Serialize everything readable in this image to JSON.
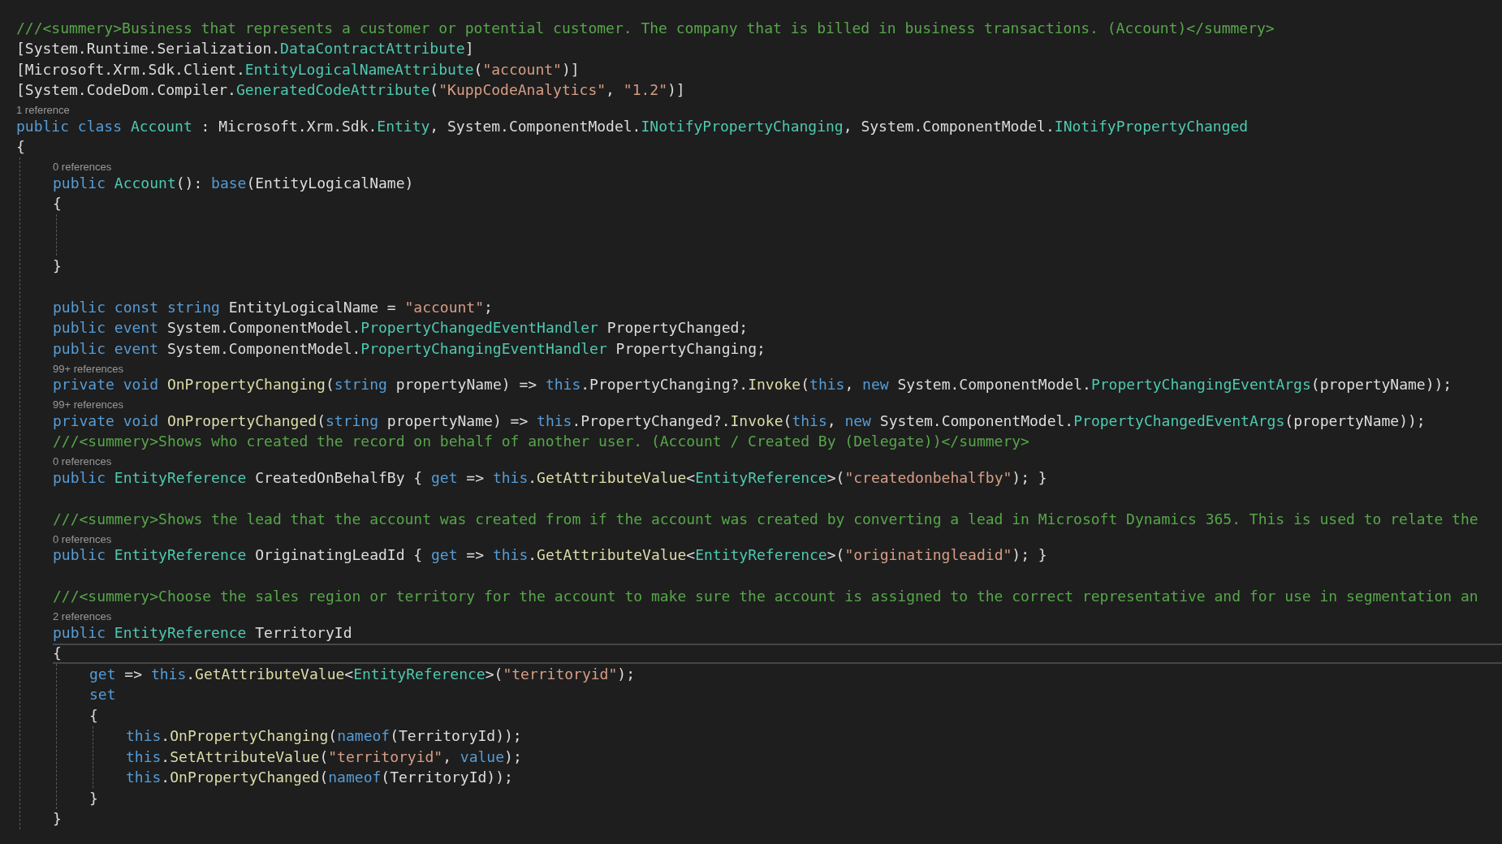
{
  "editor": {
    "lines": [
      {
        "kind": "code",
        "current": false,
        "tokens": [
          {
            "kind": "comment",
            "text": "///<summery>Business that represents a customer or potential customer. The company that is billed in business transactions. (Account)</summery>"
          }
        ]
      },
      {
        "kind": "code",
        "current": false,
        "tokens": [
          {
            "kind": "plain",
            "text": "[System.Runtime.Serialization."
          },
          {
            "kind": "type",
            "text": "DataContractAttribute"
          },
          {
            "kind": "plain",
            "text": "]"
          }
        ]
      },
      {
        "kind": "code",
        "current": false,
        "tokens": [
          {
            "kind": "plain",
            "text": "[Microsoft.Xrm.Sdk.Client."
          },
          {
            "kind": "type",
            "text": "EntityLogicalNameAttribute"
          },
          {
            "kind": "plain",
            "text": "("
          },
          {
            "kind": "string",
            "text": "\"account\""
          },
          {
            "kind": "plain",
            "text": ")]"
          }
        ]
      },
      {
        "kind": "code",
        "current": false,
        "tokens": [
          {
            "kind": "plain",
            "text": "[System.CodeDom.Compiler."
          },
          {
            "kind": "type",
            "text": "GeneratedCodeAttribute"
          },
          {
            "kind": "plain",
            "text": "("
          },
          {
            "kind": "string",
            "text": "\"KuppCodeAnalytics\""
          },
          {
            "kind": "plain",
            "text": ", "
          },
          {
            "kind": "string",
            "text": "\"1.2\""
          },
          {
            "kind": "plain",
            "text": ")]"
          }
        ]
      },
      {
        "kind": "lens",
        "text": "1 reference"
      },
      {
        "kind": "code",
        "current": false,
        "tokens": [
          {
            "kind": "keyword",
            "text": "public class "
          },
          {
            "kind": "type",
            "text": "Account"
          },
          {
            "kind": "plain",
            "text": " : Microsoft.Xrm.Sdk."
          },
          {
            "kind": "type",
            "text": "Entity"
          },
          {
            "kind": "plain",
            "text": ", System.ComponentModel."
          },
          {
            "kind": "type",
            "text": "INotifyPropertyChanging"
          },
          {
            "kind": "plain",
            "text": ", System.ComponentModel."
          },
          {
            "kind": "type",
            "text": "INotifyPropertyChanged"
          }
        ]
      },
      {
        "kind": "code",
        "current": false,
        "tokens": [
          {
            "kind": "plain",
            "text": "{"
          }
        ],
        "children": [
          {
            "kind": "lens",
            "text": "0 references"
          },
          {
            "kind": "code",
            "current": false,
            "tokens": [
              {
                "kind": "keyword",
                "text": "public "
              },
              {
                "kind": "type",
                "text": "Account"
              },
              {
                "kind": "plain",
                "text": "(): "
              },
              {
                "kind": "keyword",
                "text": "base"
              },
              {
                "kind": "plain",
                "text": "(EntityLogicalName)"
              }
            ]
          },
          {
            "kind": "code",
            "current": false,
            "tokens": [
              {
                "kind": "plain",
                "text": "{"
              }
            ],
            "children": [
              {
                "kind": "blank"
              },
              {
                "kind": "blank"
              }
            ]
          },
          {
            "kind": "code",
            "current": false,
            "tokens": [
              {
                "kind": "plain",
                "text": "}"
              }
            ]
          },
          {
            "kind": "blank"
          },
          {
            "kind": "code",
            "current": false,
            "tokens": [
              {
                "kind": "keyword",
                "text": "public const string "
              },
              {
                "kind": "plain",
                "text": "EntityLogicalName = "
              },
              {
                "kind": "string",
                "text": "\"account\""
              },
              {
                "kind": "plain",
                "text": ";"
              }
            ]
          },
          {
            "kind": "code",
            "current": false,
            "tokens": [
              {
                "kind": "keyword",
                "text": "public event "
              },
              {
                "kind": "plain",
                "text": "System.ComponentModel."
              },
              {
                "kind": "type",
                "text": "PropertyChangedEventHandler"
              },
              {
                "kind": "plain",
                "text": " PropertyChanged;"
              }
            ]
          },
          {
            "kind": "code",
            "current": false,
            "tokens": [
              {
                "kind": "keyword",
                "text": "public event "
              },
              {
                "kind": "plain",
                "text": "System.ComponentModel."
              },
              {
                "kind": "type",
                "text": "PropertyChangingEventHandler"
              },
              {
                "kind": "plain",
                "text": " PropertyChanging;"
              }
            ]
          },
          {
            "kind": "lens",
            "text": "99+ references"
          },
          {
            "kind": "code",
            "current": false,
            "tokens": [
              {
                "kind": "keyword",
                "text": "private void "
              },
              {
                "kind": "method",
                "text": "OnPropertyChanging"
              },
              {
                "kind": "plain",
                "text": "("
              },
              {
                "kind": "keyword",
                "text": "string"
              },
              {
                "kind": "plain",
                "text": " propertyName) => "
              },
              {
                "kind": "keyword",
                "text": "this"
              },
              {
                "kind": "plain",
                "text": ".PropertyChanging?."
              },
              {
                "kind": "method",
                "text": "Invoke"
              },
              {
                "kind": "plain",
                "text": "("
              },
              {
                "kind": "keyword",
                "text": "this"
              },
              {
                "kind": "plain",
                "text": ", "
              },
              {
                "kind": "keyword",
                "text": "new"
              },
              {
                "kind": "plain",
                "text": " System.ComponentModel."
              },
              {
                "kind": "type",
                "text": "PropertyChangingEventArgs"
              },
              {
                "kind": "plain",
                "text": "(propertyName));"
              }
            ]
          },
          {
            "kind": "lens",
            "text": "99+ references"
          },
          {
            "kind": "code",
            "current": false,
            "tokens": [
              {
                "kind": "keyword",
                "text": "private void "
              },
              {
                "kind": "method",
                "text": "OnPropertyChanged"
              },
              {
                "kind": "plain",
                "text": "("
              },
              {
                "kind": "keyword",
                "text": "string"
              },
              {
                "kind": "plain",
                "text": " propertyName) => "
              },
              {
                "kind": "keyword",
                "text": "this"
              },
              {
                "kind": "plain",
                "text": ".PropertyChanged?."
              },
              {
                "kind": "method",
                "text": "Invoke"
              },
              {
                "kind": "plain",
                "text": "("
              },
              {
                "kind": "keyword",
                "text": "this"
              },
              {
                "kind": "plain",
                "text": ", "
              },
              {
                "kind": "keyword",
                "text": "new"
              },
              {
                "kind": "plain",
                "text": " System.ComponentModel."
              },
              {
                "kind": "type",
                "text": "PropertyChangedEventArgs"
              },
              {
                "kind": "plain",
                "text": "(propertyName));"
              }
            ]
          },
          {
            "kind": "code",
            "current": false,
            "tokens": [
              {
                "kind": "comment",
                "text": "///<summery>Shows who created the record on behalf of another user. (Account / Created By (Delegate))</summery>"
              }
            ]
          },
          {
            "kind": "lens",
            "text": "0 references"
          },
          {
            "kind": "code",
            "current": false,
            "tokens": [
              {
                "kind": "keyword",
                "text": "public "
              },
              {
                "kind": "type",
                "text": "EntityReference"
              },
              {
                "kind": "plain",
                "text": " CreatedOnBehalfBy { "
              },
              {
                "kind": "keyword",
                "text": "get"
              },
              {
                "kind": "plain",
                "text": " => "
              },
              {
                "kind": "keyword",
                "text": "this"
              },
              {
                "kind": "plain",
                "text": "."
              },
              {
                "kind": "method",
                "text": "GetAttributeValue"
              },
              {
                "kind": "plain",
                "text": "<"
              },
              {
                "kind": "type",
                "text": "EntityReference"
              },
              {
                "kind": "plain",
                "text": ">("
              },
              {
                "kind": "string",
                "text": "\"createdonbehalfby\""
              },
              {
                "kind": "plain",
                "text": "); }"
              }
            ]
          },
          {
            "kind": "blank"
          },
          {
            "kind": "code",
            "current": false,
            "tokens": [
              {
                "kind": "comment",
                "text": "///<summery>Shows the lead that the account was created from if the account was created by converting a lead in Microsoft Dynamics 365. This is used to relate the"
              }
            ]
          },
          {
            "kind": "lens",
            "text": "0 references"
          },
          {
            "kind": "code",
            "current": false,
            "tokens": [
              {
                "kind": "keyword",
                "text": "public "
              },
              {
                "kind": "type",
                "text": "EntityReference"
              },
              {
                "kind": "plain",
                "text": " OriginatingLeadId { "
              },
              {
                "kind": "keyword",
                "text": "get"
              },
              {
                "kind": "plain",
                "text": " => "
              },
              {
                "kind": "keyword",
                "text": "this"
              },
              {
                "kind": "plain",
                "text": "."
              },
              {
                "kind": "method",
                "text": "GetAttributeValue"
              },
              {
                "kind": "plain",
                "text": "<"
              },
              {
                "kind": "type",
                "text": "EntityReference"
              },
              {
                "kind": "plain",
                "text": ">("
              },
              {
                "kind": "string",
                "text": "\"originatingleadid\""
              },
              {
                "kind": "plain",
                "text": "); }"
              }
            ]
          },
          {
            "kind": "blank"
          },
          {
            "kind": "code",
            "current": false,
            "tokens": [
              {
                "kind": "comment",
                "text": "///<summery>Choose the sales region or territory for the account to make sure the account is assigned to the correct representative and for use in segmentation an"
              }
            ]
          },
          {
            "kind": "lens",
            "text": "2 references"
          },
          {
            "kind": "code",
            "current": false,
            "tokens": [
              {
                "kind": "keyword",
                "text": "public "
              },
              {
                "kind": "type",
                "text": "EntityReference"
              },
              {
                "kind": "plain",
                "text": " TerritoryId"
              }
            ]
          },
          {
            "kind": "code",
            "current": true,
            "tokens": [
              {
                "kind": "plain",
                "text": "{"
              }
            ],
            "children": [
              {
                "kind": "code",
                "current": false,
                "tokens": [
                  {
                    "kind": "keyword",
                    "text": "get"
                  },
                  {
                    "kind": "plain",
                    "text": " => "
                  },
                  {
                    "kind": "keyword",
                    "text": "this"
                  },
                  {
                    "kind": "plain",
                    "text": "."
                  },
                  {
                    "kind": "method",
                    "text": "GetAttributeValue"
                  },
                  {
                    "kind": "plain",
                    "text": "<"
                  },
                  {
                    "kind": "type",
                    "text": "EntityReference"
                  },
                  {
                    "kind": "plain",
                    "text": ">("
                  },
                  {
                    "kind": "string",
                    "text": "\"territoryid\""
                  },
                  {
                    "kind": "plain",
                    "text": ");"
                  }
                ]
              },
              {
                "kind": "code",
                "current": false,
                "tokens": [
                  {
                    "kind": "keyword",
                    "text": "set"
                  }
                ]
              },
              {
                "kind": "code",
                "current": false,
                "tokens": [
                  {
                    "kind": "plain",
                    "text": "{"
                  }
                ],
                "children": [
                  {
                    "kind": "code",
                    "current": false,
                    "tokens": [
                      {
                        "kind": "keyword",
                        "text": "this"
                      },
                      {
                        "kind": "plain",
                        "text": "."
                      },
                      {
                        "kind": "method",
                        "text": "OnPropertyChanging"
                      },
                      {
                        "kind": "plain",
                        "text": "("
                      },
                      {
                        "kind": "keyword",
                        "text": "nameof"
                      },
                      {
                        "kind": "plain",
                        "text": "(TerritoryId));"
                      }
                    ]
                  },
                  {
                    "kind": "code",
                    "current": false,
                    "tokens": [
                      {
                        "kind": "keyword",
                        "text": "this"
                      },
                      {
                        "kind": "plain",
                        "text": "."
                      },
                      {
                        "kind": "method",
                        "text": "SetAttributeValue"
                      },
                      {
                        "kind": "plain",
                        "text": "("
                      },
                      {
                        "kind": "string",
                        "text": "\"territoryid\""
                      },
                      {
                        "kind": "plain",
                        "text": ", "
                      },
                      {
                        "kind": "keyword",
                        "text": "value"
                      },
                      {
                        "kind": "plain",
                        "text": ");"
                      }
                    ]
                  },
                  {
                    "kind": "code",
                    "current": false,
                    "tokens": [
                      {
                        "kind": "keyword",
                        "text": "this"
                      },
                      {
                        "kind": "plain",
                        "text": "."
                      },
                      {
                        "kind": "method",
                        "text": "OnPropertyChanged"
                      },
                      {
                        "kind": "plain",
                        "text": "("
                      },
                      {
                        "kind": "keyword",
                        "text": "nameof"
                      },
                      {
                        "kind": "plain",
                        "text": "(TerritoryId));"
                      }
                    ]
                  }
                ]
              },
              {
                "kind": "code",
                "current": false,
                "tokens": [
                  {
                    "kind": "plain",
                    "text": "}"
                  }
                ]
              }
            ]
          },
          {
            "kind": "code",
            "current": false,
            "tokens": [
              {
                "kind": "plain",
                "text": "}"
              }
            ]
          }
        ]
      }
    ]
  }
}
